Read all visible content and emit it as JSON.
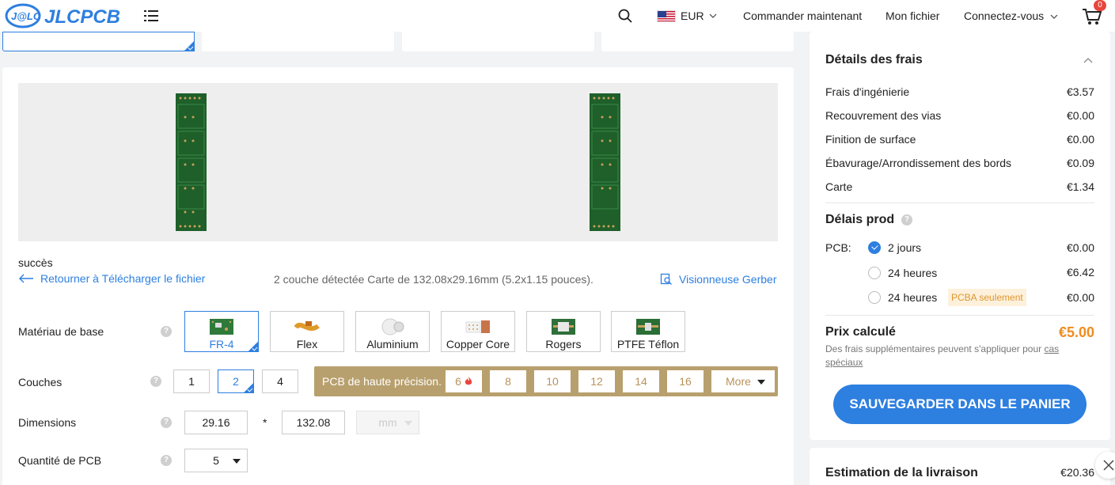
{
  "nav": {
    "brand": "JLCPCB",
    "currency": "EUR",
    "links": [
      "Commander maintenant",
      "Mon fichier",
      "Connectez-vous"
    ],
    "cart_count": "0"
  },
  "upload": {
    "status": "succès",
    "back_link": "Retourner à Télécharger le fichier",
    "detected": "2 couche détectée Carte de 132.08x29.16mm (5.2x1.15 pouces).",
    "gerber_viewer": "Visionneuse Gerber"
  },
  "form": {
    "base_material": {
      "label": "Matériau de base",
      "options": [
        "FR-4",
        "Flex",
        "Aluminium",
        "Copper Core",
        "Rogers",
        "PTFE Téflon"
      ],
      "selected": "FR-4"
    },
    "layers": {
      "label": "Couches",
      "options": [
        "1",
        "2",
        "4"
      ],
      "selected": "2",
      "high_precision_label": "PCB de haute précision.",
      "high_precision_options": [
        "6",
        "8",
        "10",
        "12",
        "14",
        "16"
      ],
      "more": "More"
    },
    "dimensions": {
      "label": "Dimensions",
      "width": "29.16",
      "separator": "*",
      "height": "132.08",
      "unit": "mm"
    },
    "quantity": {
      "label": "Quantité de PCB",
      "value": "5"
    }
  },
  "fees": {
    "title": "Détails des frais",
    "items": [
      {
        "label": "Frais d'ingénierie",
        "value": "€3.57"
      },
      {
        "label": "Recouvrement des vias",
        "value": "€0.00"
      },
      {
        "label": "Finition de surface",
        "value": "€0.00"
      },
      {
        "label": "Ébavurage/Arrondissement des bords",
        "value": "€0.09"
      },
      {
        "label": "Carte",
        "value": "€1.34"
      }
    ],
    "lead_time": {
      "title": "Délais prod",
      "pcb_label": "PCB:",
      "options": [
        {
          "label": "2 jours",
          "value": "€0.00",
          "checked": true
        },
        {
          "label": "24 heures",
          "value": "€6.42",
          "checked": false
        },
        {
          "label": "24 heures",
          "value": "€0.00",
          "checked": false,
          "badge": "PCBA seulement"
        }
      ]
    },
    "total_label": "Prix calculé",
    "total_value": "€5.00",
    "note": "Des frais supplémentaires peuvent s'appliquer pour",
    "note_link": "cas spéciaux",
    "save_button": "SAUVEGARDER DANS LE PANIER"
  },
  "shipping": {
    "title": "Estimation de la livraison",
    "value": "€20.36"
  },
  "colors": {
    "accent": "#2d7fe0",
    "price": "#f08c1e",
    "gold": "#b8a06e",
    "pcb_green": "#1f5f2a"
  }
}
